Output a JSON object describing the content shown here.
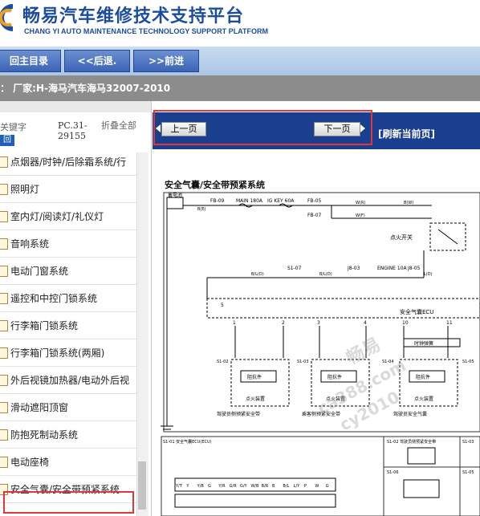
{
  "header": {
    "title": "畅易汽车维修技术支持平台",
    "subtitle": "CHANG YI AUTO MAINTENANCE TECHNOLOGY SUPPORT PLATFORM",
    "brand_color": "#1c4c9c"
  },
  "nav": {
    "home": "回主目录",
    "back": "<<后退.",
    "forward": ">>前进"
  },
  "breadcrumb": "： 厂家:H-海马汽车海马32007-2010",
  "left": {
    "keyword_label": "关键字",
    "code_label": "PC.31-29155",
    "collapse_label": "折叠全部",
    "tab_label": "回",
    "items": [
      "点烟器/时钟/后除霜系统/行",
      "照明灯",
      "室内灯/阅读灯/礼仪灯",
      "音响系统",
      "电动门窗系统",
      "遥控和中控门锁系统",
      "行李箱门锁系统",
      "行李箱门锁系统(两厢)",
      "外后视镜加热器/电动外后视",
      "滑动遮阳顶窗",
      "防抱死制动系统",
      "电动座椅",
      "安全气囊/安全带预紧系统"
    ]
  },
  "pager": {
    "prev": "上一页",
    "next": "下一页",
    "refresh": "[刷新当前页]"
  },
  "diagram": {
    "title": "安全气囊/安全带预紧系统",
    "battery": "蓄电池",
    "fuses": [
      "FB-09",
      "MAIN 180A",
      "IG KEY 60A",
      "FB-05",
      "FB-07"
    ],
    "ignition": "点火开关",
    "ecu": "安全气囊ECU",
    "connectors": [
      "S1-07",
      "J8-03",
      "ENGINE 10A",
      "J8-05"
    ],
    "wires": [
      "B(E)",
      "B/L(D)",
      "B/L(D)",
      "L(D)",
      "W(R)",
      "W(F)",
      "B(W)"
    ],
    "pins": [
      "5",
      "1",
      "2",
      "3",
      "4",
      "10",
      "11"
    ],
    "modules": [
      "S1-02",
      "S1-03",
      "S1-04",
      "S1-05"
    ],
    "module_labels": [
      "驾驶员侧预紧安全带",
      "乘客侧预紧安全带",
      "驾驶员安全气囊",
      "乘客安全气囊"
    ],
    "module_parts": [
      "点火装置",
      "点火装置",
      "点火装置",
      "点火装置"
    ],
    "resistors": [
      "阻抗件",
      "阻抗件",
      "阻抗件",
      "阻抗件"
    ],
    "clock_spring": "时钟弹簧",
    "bottom_labels": [
      "S1-01 安全气囊ECU(ECU)",
      "S1-02 驾驶员侧预紧安全带",
      "S1-03",
      "S1-06",
      "S1-05"
    ],
    "pin_codes": [
      "Y/T",
      "Y",
      "Y/B",
      "G",
      "Y/R",
      "G/R",
      "G/Y",
      "W/B",
      "B/R",
      "B",
      "B/L",
      "L/Y",
      "P",
      "W",
      "G"
    ]
  },
  "watermark": [
    "畅易",
    "ca388.com",
    "cy2010"
  ]
}
